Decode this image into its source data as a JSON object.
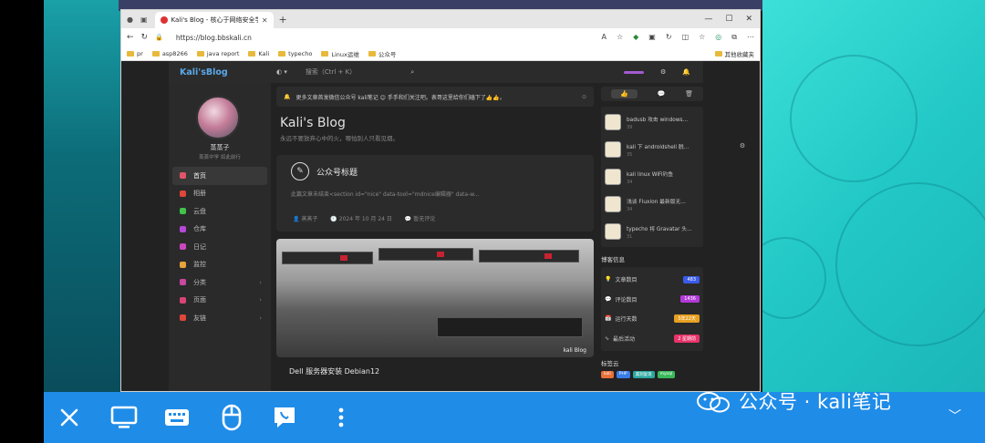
{
  "browser": {
    "tab_title": "Kali's Blog - 核心于网络安全学习",
    "url": "https://blog.bbskali.cn",
    "bookmarks": [
      "pr",
      "asp8266",
      "java report",
      "Kali",
      "typecho",
      "Linux运维",
      "公众号"
    ],
    "bookmarks_right": "其他收藏夹"
  },
  "site": {
    "logo": "Kali'sBlog",
    "search_placeholder": "搜索（Ctrl + K）",
    "user_name": "蒸蒸子",
    "user_sub": "蒸蒸中学 如此前行",
    "nav": [
      {
        "label": "首页",
        "color": "#e2546a"
      },
      {
        "label": "相册",
        "color": "#e0463a"
      },
      {
        "label": "云盘",
        "color": "#41c24a"
      },
      {
        "label": "仓库",
        "color": "#b548d8"
      },
      {
        "label": "日记",
        "color": "#c948c0"
      },
      {
        "label": "监控",
        "color": "#e8a43a"
      },
      {
        "label": "分类",
        "color": "#c848a0"
      },
      {
        "label": "页面",
        "color": "#d84478"
      },
      {
        "label": "友链",
        "color": "#e0463a"
      }
    ],
    "notice": "更多文章首发微信公众号 kali笔记 😊 手手和们关注吧。表哥这里给你们磕下了👍👍。",
    "blog_title": "Kali's Blog",
    "blog_subtitle": "永远不要放弃心中的火，哪怕别人只看见烟。",
    "post1": {
      "title": "公众号标题",
      "excerpt": "此篇文章未结束<section id=\"nice\" data-tool=\"mdnice编辑器\" data-w...",
      "author": "蒸蒸子",
      "date": "2024 年 10 月 24 日",
      "comments": "暂无评论"
    },
    "image_watermark": "kali Blog",
    "post2_title": "Dell 服务器安装 Debian12",
    "right_tabs": [
      "👍",
      "💬",
      "🗑"
    ],
    "hot_posts": [
      {
        "title": "badusb 攻击 windows...",
        "count": "39"
      },
      {
        "title": "kali 下 androidshell 脱...",
        "count": "35"
      },
      {
        "title": "kali linux WiFi钓鱼",
        "count": "34"
      },
      {
        "title": "浅谈 Fluxion 最新版无...",
        "count": "34"
      },
      {
        "title": "typecho 将 Gravatar 头...",
        "count": "31"
      }
    ],
    "blog_info_title": "博客信息",
    "stats": [
      {
        "label": "文章数目",
        "value": "483",
        "color": "#3a5ce8"
      },
      {
        "label": "评论数目",
        "value": "1436",
        "color": "#b33ad8"
      },
      {
        "label": "运行天数",
        "value": "5年22天",
        "color": "#e8a020"
      },
      {
        "label": "最后活动",
        "value": "2 星期前",
        "color": "#e8336a"
      }
    ],
    "tags_title": "标签云",
    "tags": [
      {
        "label": "kali",
        "color": "#e8703a"
      },
      {
        "label": "PHP",
        "color": "#3a7ce8"
      },
      {
        "label": "漏洞复现",
        "color": "#2aa8a0"
      },
      {
        "label": "mysql",
        "color": "#3ab85a"
      }
    ]
  },
  "toolbar": {
    "watermark": "公众号 · kali笔记"
  }
}
